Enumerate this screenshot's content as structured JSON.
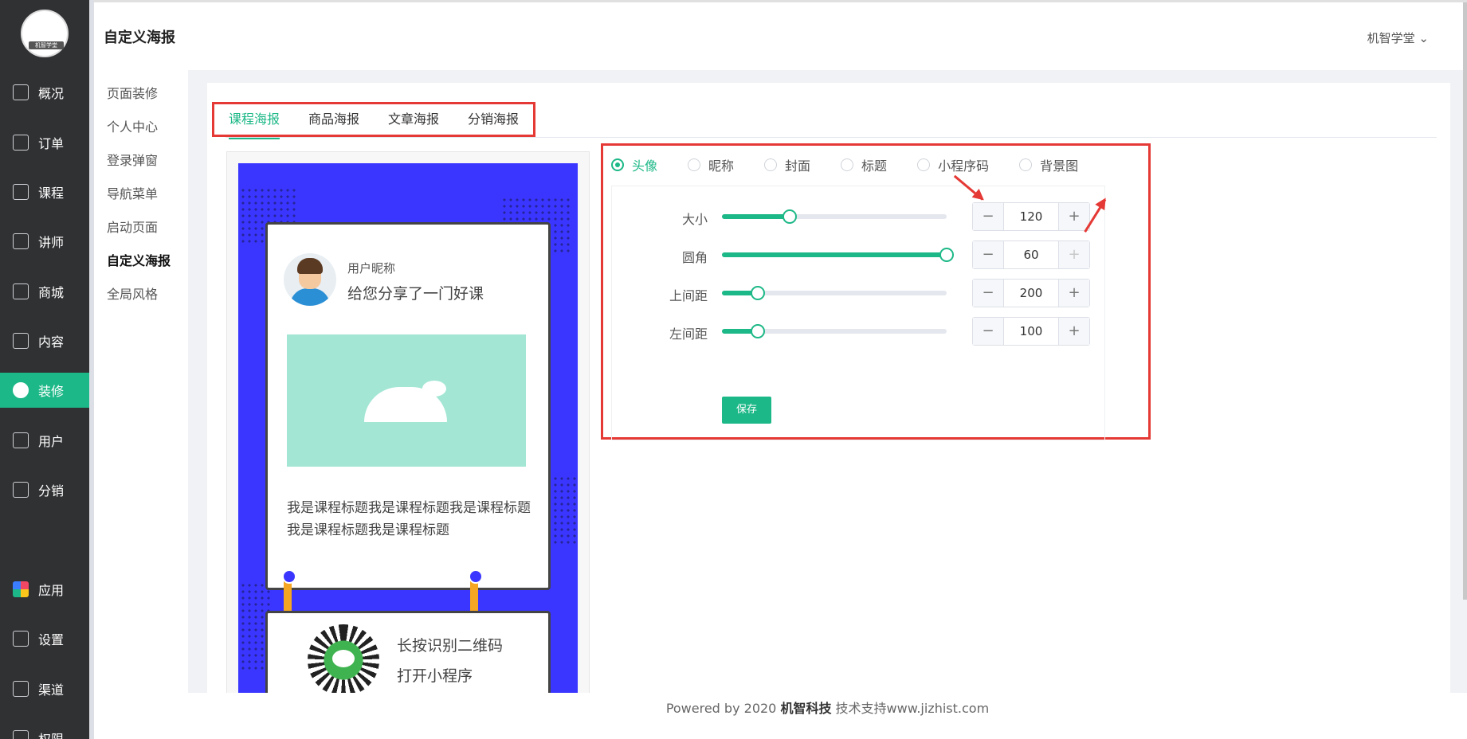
{
  "brand": {
    "logo_text": "机智学堂"
  },
  "nav": [
    {
      "label": "概况",
      "icon": "home-icon"
    },
    {
      "label": "订单",
      "icon": "order-icon"
    },
    {
      "label": "课程",
      "icon": "course-icon"
    },
    {
      "label": "讲师",
      "icon": "teacher-icon"
    },
    {
      "label": "商城",
      "icon": "store-icon"
    },
    {
      "label": "内容",
      "icon": "content-icon"
    },
    {
      "label": "装修",
      "icon": "decorate-icon"
    },
    {
      "label": "用户",
      "icon": "user-icon"
    },
    {
      "label": "分销",
      "icon": "distribution-icon"
    },
    {
      "label": "应用",
      "icon": "apps-icon"
    },
    {
      "label": "设置",
      "icon": "gear-icon"
    },
    {
      "label": "渠道",
      "icon": "link-icon"
    },
    {
      "label": "权限",
      "icon": "lock-icon"
    }
  ],
  "header": {
    "title": "自定义海报",
    "user": "机智学堂"
  },
  "subnav": [
    "页面装修",
    "个人中心",
    "登录弹窗",
    "导航菜单",
    "启动页面",
    "自定义海报",
    "全局风格"
  ],
  "tabs": [
    "课程海报",
    "商品海报",
    "文章海报",
    "分销海报"
  ],
  "poster": {
    "nickname": "用户昵称",
    "share_text": "给您分享了一门好课",
    "course_title": "我是课程标题我是课程标题我是课程标题我是课程标题我是课程标题",
    "scan_text": "长按识别二维码",
    "open_text": "打开小程序"
  },
  "radios": [
    "头像",
    "昵称",
    "封面",
    "标题",
    "小程序码",
    "背景图"
  ],
  "settings": [
    {
      "label": "大小",
      "value": "120",
      "minus": "−",
      "plus": "+",
      "level": 0.3
    },
    {
      "label": "圆角",
      "value": "60",
      "minus": "−",
      "plus": "+",
      "level": 1.0
    },
    {
      "label": "上间距",
      "value": "200",
      "minus": "−",
      "plus": "+",
      "level": 0.16
    },
    {
      "label": "左间距",
      "value": "100",
      "minus": "−",
      "plus": "+",
      "level": 0.16
    }
  ],
  "save_label": "保存",
  "footer": {
    "prefix": "Powered by 2020 ",
    "company": "机智科技",
    "suffix": " 技术支持www.jizhist.com"
  },
  "colors": {
    "accent": "#1db887",
    "sidebar": "#303133",
    "annotation": "#e53935",
    "poster_bg": "#3a36ff"
  }
}
